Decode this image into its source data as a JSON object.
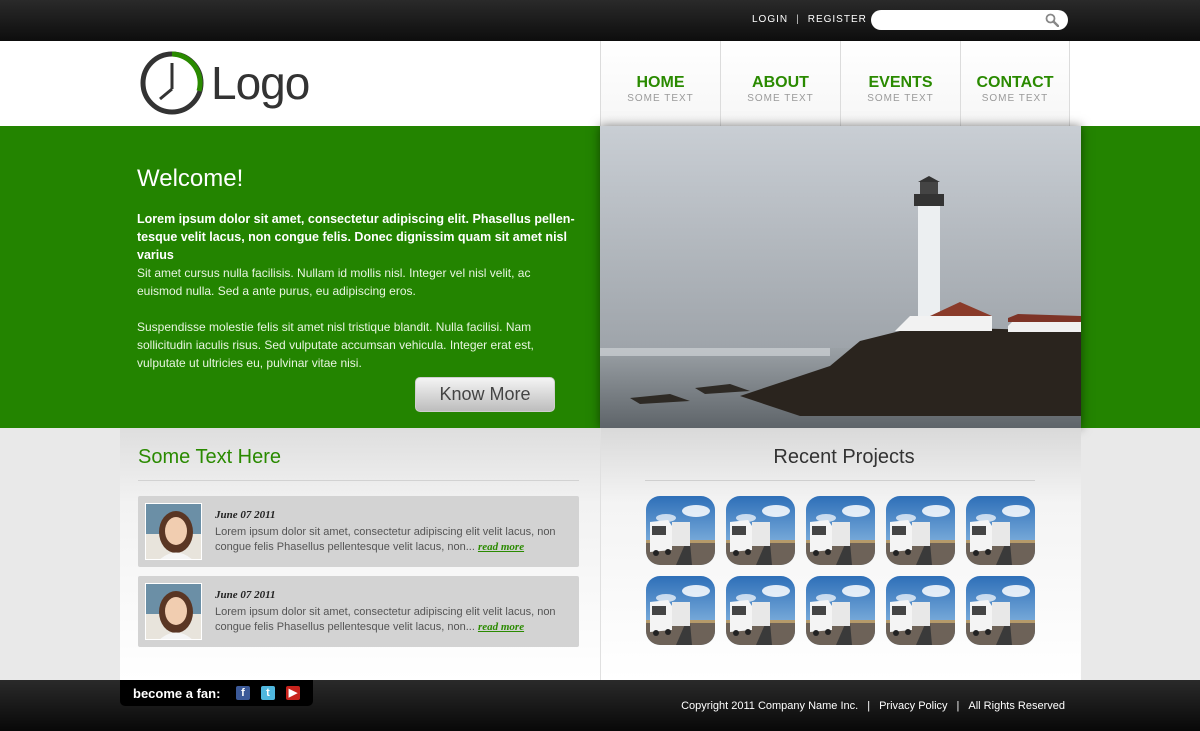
{
  "topbar": {
    "login_label": "LOGIN",
    "register_label": "REGISTER",
    "separator": "|",
    "search_placeholder": ""
  },
  "header": {
    "logo_text": "Logo"
  },
  "nav": [
    {
      "title": "HOME",
      "sub": "SOME TEXT"
    },
    {
      "title": "ABOUT",
      "sub": "SOME TEXT"
    },
    {
      "title": "EVENTS",
      "sub": "SOME TEXT"
    },
    {
      "title": "CONTACT",
      "sub": "SOME TEXT"
    }
  ],
  "hero": {
    "title": "Welcome!",
    "bold_text": "Lorem ipsum dolor sit amet, consectetur adipiscing elit. Phasellus pellen-tesque velit lacus, non congue felis. Donec dignissim quam sit amet nisl varius",
    "paragraph1": "Sit amet cursus nulla facilisis. Nullam id mollis nisl. Integer vel nisl velit, ac euismod nulla. Sed a ante purus, eu adipiscing eros.",
    "paragraph2": "Suspendisse molestie felis sit amet nisl tristique blandit. Nulla facilisi. Nam sollicitudin iaculis risus. Sed vulputate accumsan vehicula. Integer erat est, vulputate ut ultricies eu, pulvinar vitae nisi.",
    "button_label": "Know More"
  },
  "left_section": {
    "title": "Some Text Here",
    "news": [
      {
        "date": "June 07 2011",
        "text": "Lorem ipsum dolor sit amet, consectetur adipiscing elit velit lacus, non congue felis Phasellus pellentesque velit lacus, non...",
        "link": "read more"
      },
      {
        "date": "June 07 2011",
        "text": "Lorem ipsum dolor sit amet, consectetur adipiscing elit velit lacus, non congue felis Phasellus pellentesque velit lacus, non...",
        "link": "read more"
      }
    ]
  },
  "right_section": {
    "title": "Recent Projects",
    "thumbnail_count": 10
  },
  "footer": {
    "fan_label": "become a fan:",
    "social": [
      "f",
      "t",
      "▶"
    ],
    "copyright": "Copyright 2011  Company Name Inc.",
    "privacy": "Privacy Policy",
    "rights": "All Rights Reserved",
    "separator": "|"
  },
  "colors": {
    "brand_green": "#238400",
    "nav_green": "#2a8a00",
    "dark_bar": "#111111"
  }
}
